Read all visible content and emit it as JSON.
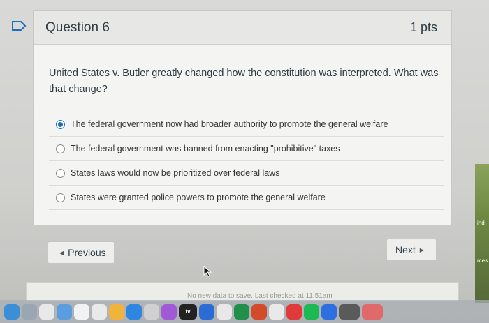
{
  "question": {
    "title": "Question 6",
    "points": "1 pts",
    "text": "United States v. Butler greatly changed how the constitution was interpreted. What was that change?"
  },
  "answers": [
    {
      "label": "The federal government now had broader authority to promote the general welfare",
      "selected": true
    },
    {
      "label": "The federal government was banned from enacting \"prohibitive\" taxes",
      "selected": false
    },
    {
      "label": "States laws would now be prioritized over federal laws",
      "selected": false
    },
    {
      "label": "States were granted police powers to promote the general welfare",
      "selected": false
    }
  ],
  "nav": {
    "previous_label": "Previous",
    "next_label": "Next"
  },
  "status": {
    "text": "No new data to save. Last checked at 11:51am"
  },
  "side_panel": {
    "line1": "ind",
    "line2": "rces"
  },
  "dock": {
    "tv_label": "tv"
  },
  "colors": {
    "accent": "#1a6fc0",
    "card_bg": "#f4f4f2",
    "header_bg": "#e7e7e5"
  }
}
